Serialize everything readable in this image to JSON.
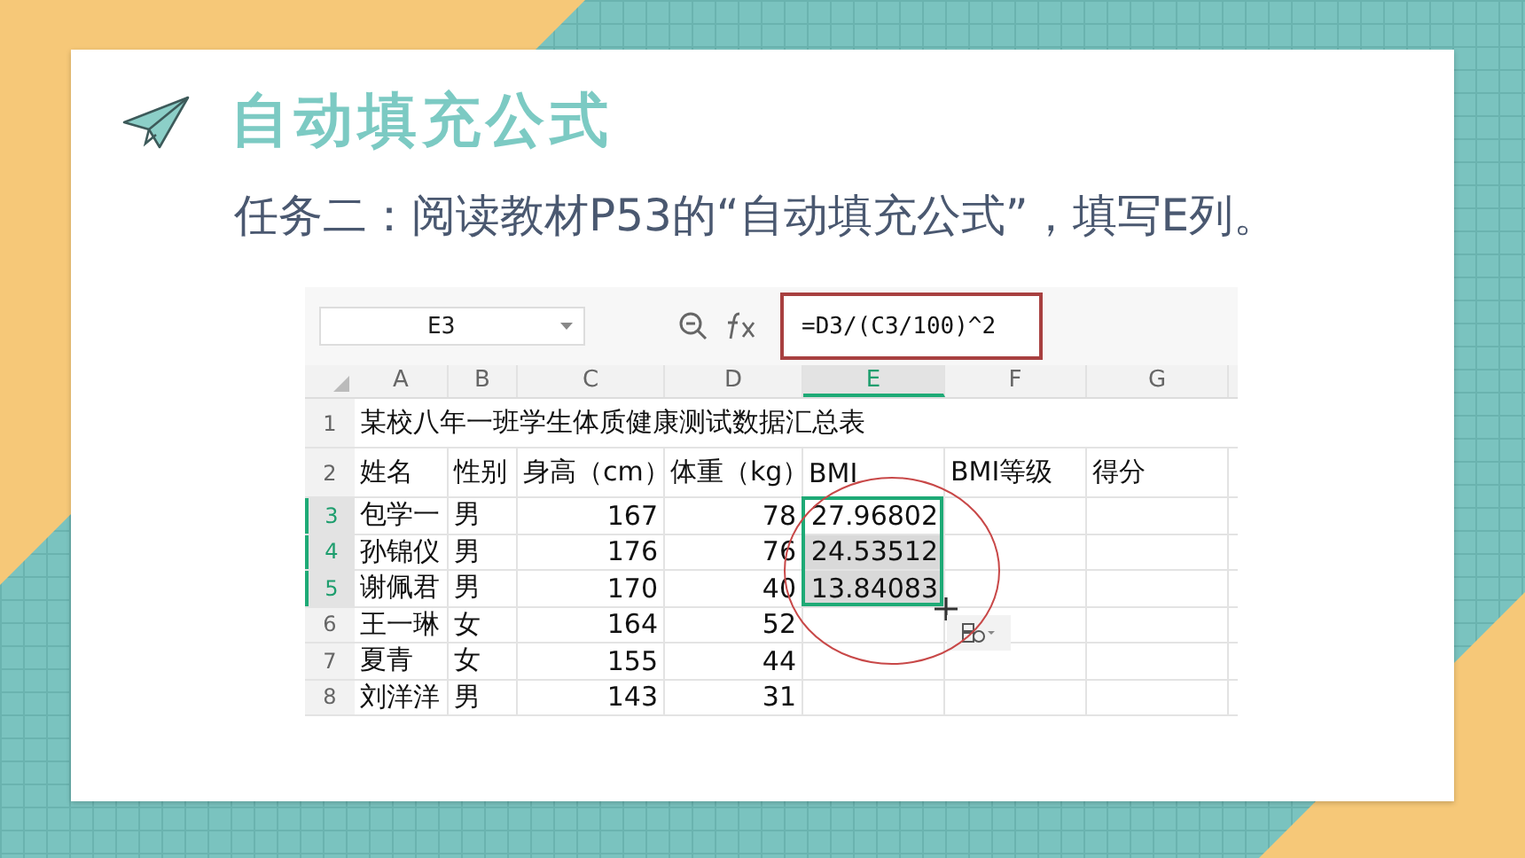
{
  "slide": {
    "title": "自动填充公式",
    "subtitle": "任务二：阅读教材P53的“自动填充公式”，填写E列。"
  },
  "spreadsheet": {
    "name_box": "E3",
    "formula": "=D3/(C3/100)^2",
    "columns": [
      {
        "label": "A",
        "selected": false
      },
      {
        "label": "B",
        "selected": false
      },
      {
        "label": "C",
        "selected": false
      },
      {
        "label": "D",
        "selected": false
      },
      {
        "label": "E",
        "selected": true
      },
      {
        "label": "F",
        "selected": false
      },
      {
        "label": "G",
        "selected": false
      }
    ],
    "rows": [
      {
        "number": "1",
        "kind": "title",
        "selected": false,
        "cells": [
          "某校八年一班学生体质健康测试数据汇总表"
        ]
      },
      {
        "number": "2",
        "kind": "header",
        "selected": false,
        "cells": [
          "姓名",
          "性别",
          "身高（cm）",
          "体重（kg）",
          "BMI",
          "BMI等级",
          "得分"
        ]
      },
      {
        "number": "3",
        "kind": "data",
        "selected": true,
        "cells": [
          "包学一",
          "男",
          "167",
          "78",
          "27.96802"
        ]
      },
      {
        "number": "4",
        "kind": "data",
        "selected": true,
        "cells": [
          "孙锦仪",
          "男",
          "176",
          "76",
          "24.53512"
        ]
      },
      {
        "number": "5",
        "kind": "data",
        "selected": true,
        "cells": [
          "谢佩君",
          "男",
          "170",
          "40",
          "13.84083"
        ]
      },
      {
        "number": "6",
        "kind": "data",
        "selected": false,
        "cells": [
          "王一琳",
          "女",
          "164",
          "52"
        ]
      },
      {
        "number": "7",
        "kind": "data",
        "selected": false,
        "cells": [
          "夏青",
          "女",
          "155",
          "44"
        ]
      },
      {
        "number": "8",
        "kind": "data",
        "selected": false,
        "cells": [
          "刘洋洋",
          "男",
          "143",
          "31"
        ]
      }
    ]
  }
}
